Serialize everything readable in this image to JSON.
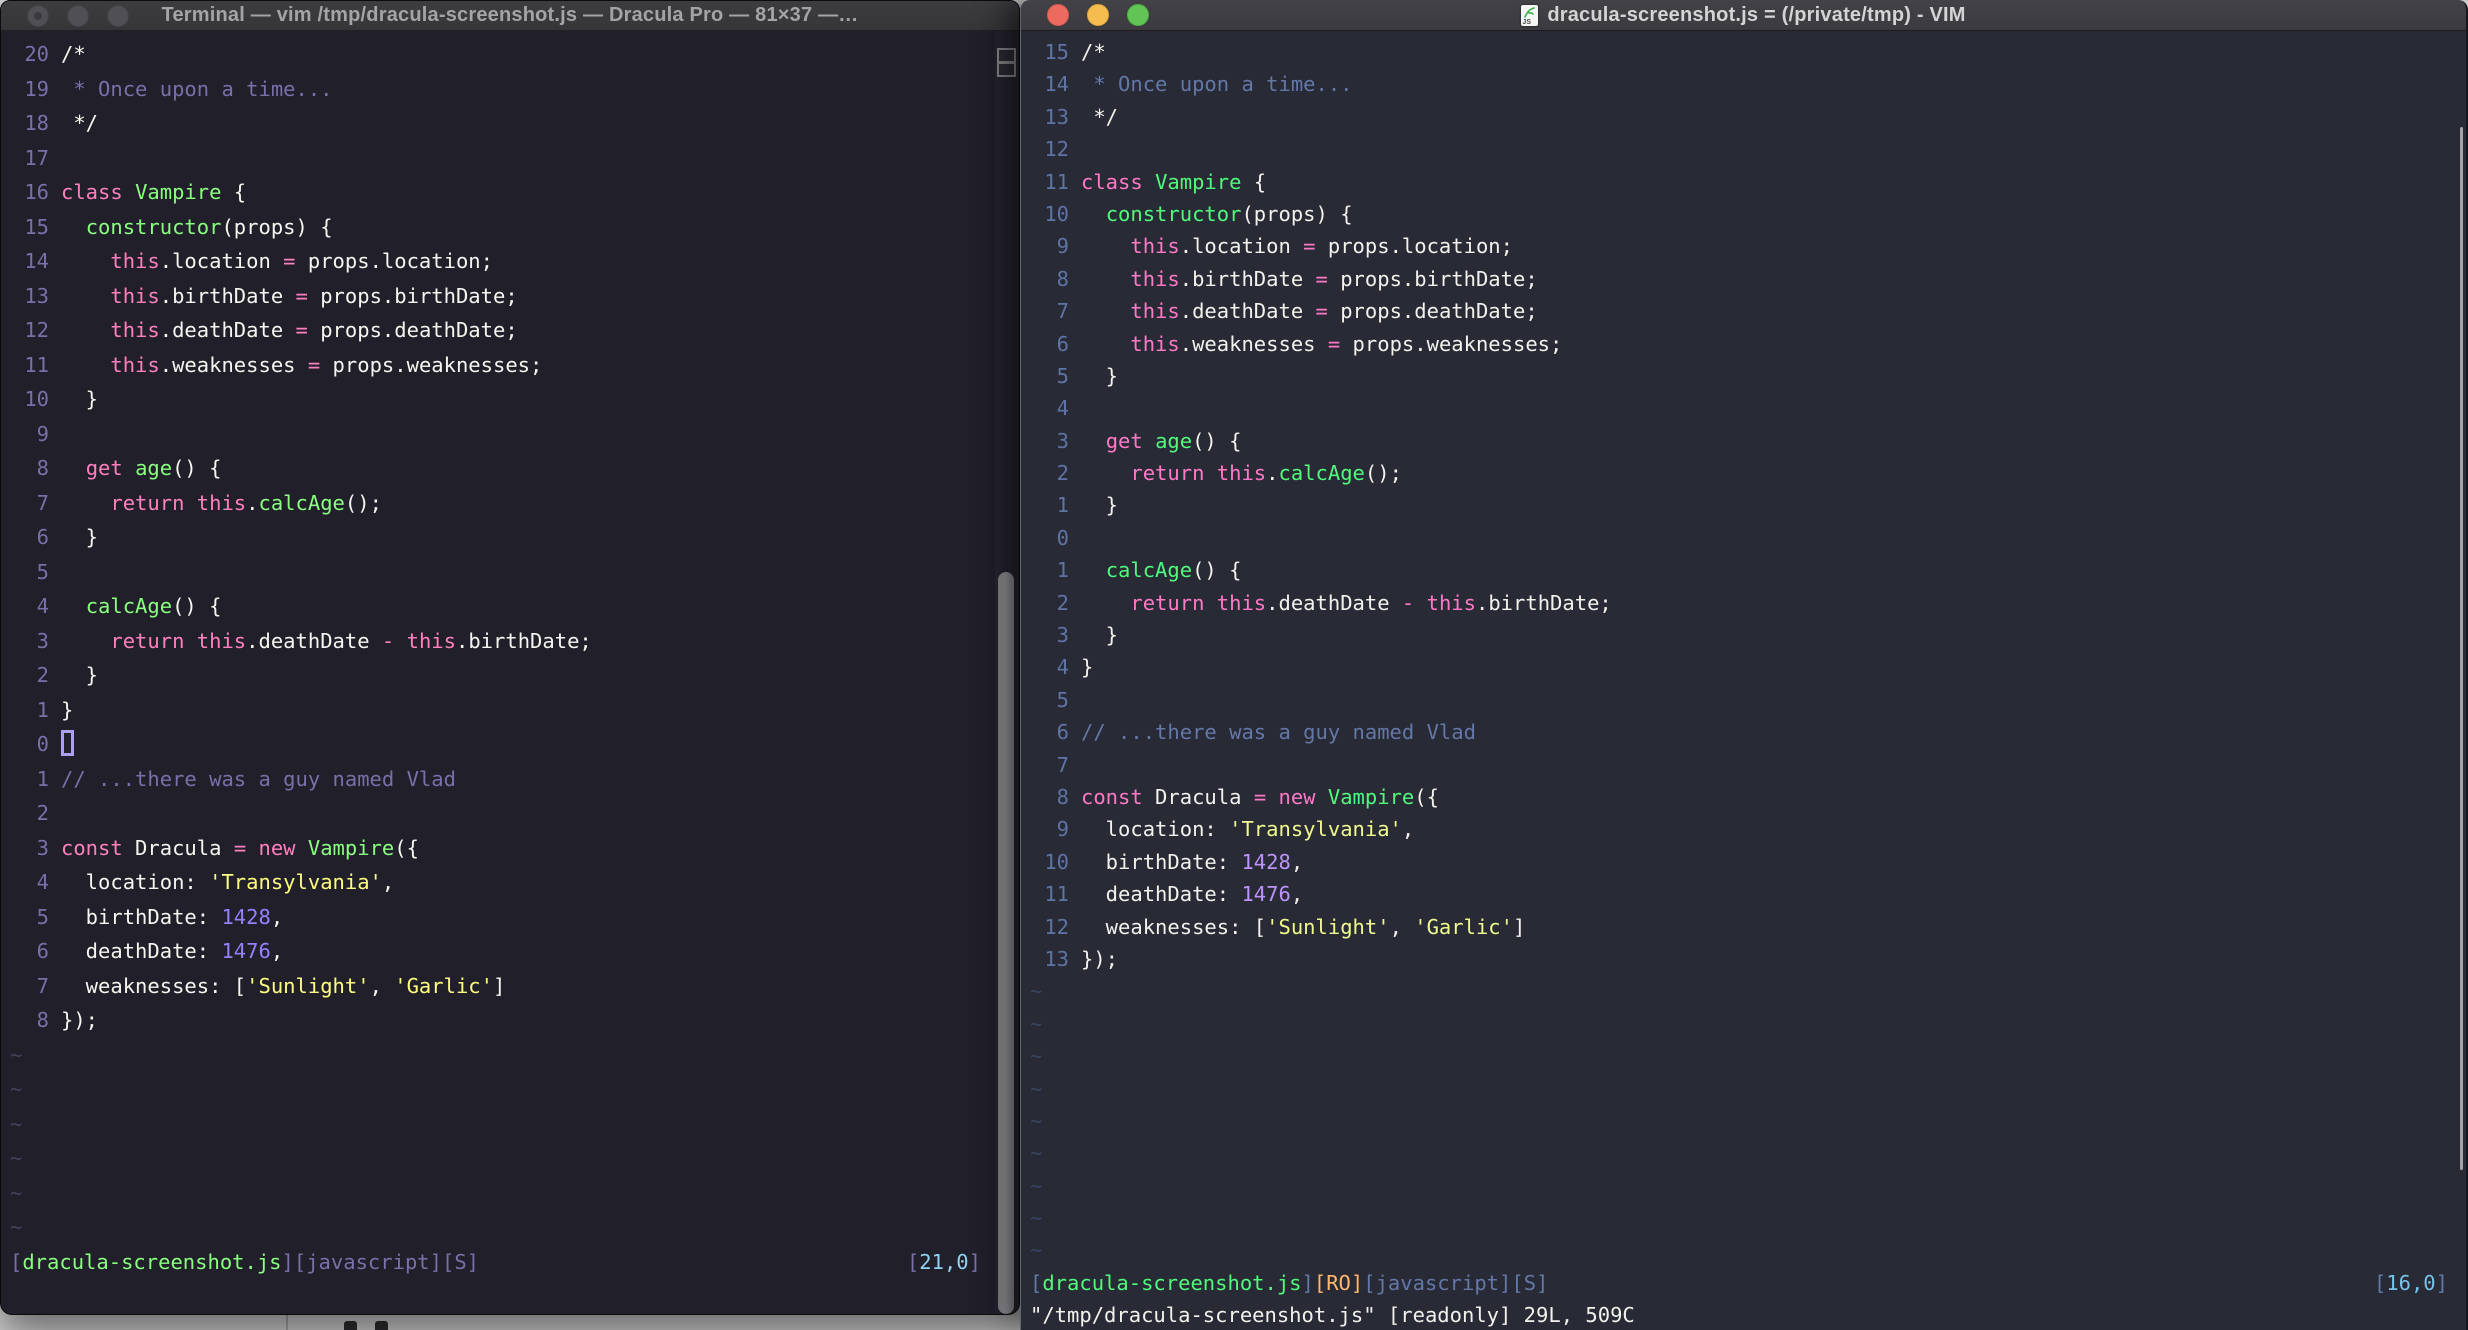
{
  "desktop": {
    "bg_color": "#d3d3d4"
  },
  "palettes": {
    "left": {
      "bg": "#201f2a",
      "fg": "#f6f6f0",
      "comment": "#7970a9",
      "pink": "#ff80bf",
      "green": "#8aff80",
      "purple": "#9580ff",
      "yellow": "#ffff80",
      "cyan": "#8fd2f2",
      "orange": "#ffca80",
      "linenr": "#7970a9",
      "tilde": "#46435a"
    },
    "right": {
      "bg": "#282a36",
      "fg": "#f2f2ec",
      "comment": "#6478a8",
      "pink": "#ff79c6",
      "green": "#50fa7b",
      "purple": "#bd93f9",
      "yellow": "#f1fa8c",
      "cyan": "#74c3e8",
      "orange": "#ffb86c",
      "linenr": "#5f74a5",
      "tilde": "#3a4463"
    }
  },
  "left_window": {
    "title": "Terminal — vim /tmp/dracula-screenshot.js — Dracula Pro — 81×37 —…",
    "palette": "left",
    "tilde_count": 6,
    "has_cmdline_text": false,
    "status_segs": [
      [
        "comment",
        "["
      ],
      [
        "green",
        "dracula-screenshot.js"
      ],
      [
        "comment",
        "][javascript][S]"
      ]
    ],
    "position_segs": [
      [
        "comment",
        "["
      ],
      [
        "cyan",
        "21,0"
      ],
      [
        "comment",
        "]"
      ]
    ],
    "cmdline_segs": [],
    "lines": [
      {
        "n": "20",
        "s": [
          [
            "fg",
            "/*"
          ]
        ]
      },
      {
        "n": "19",
        "s": [
          [
            "comment",
            " * Once upon a time..."
          ]
        ]
      },
      {
        "n": "18",
        "s": [
          [
            "fg",
            " */"
          ]
        ]
      },
      {
        "n": "17",
        "s": []
      },
      {
        "n": "16",
        "s": [
          [
            "pink",
            "class"
          ],
          [
            "fg",
            " "
          ],
          [
            "green",
            "Vampire"
          ],
          [
            "fg",
            " {"
          ]
        ]
      },
      {
        "n": "15",
        "s": [
          [
            "fg",
            "  "
          ],
          [
            "green",
            "constructor"
          ],
          [
            "fg",
            "(props) {"
          ]
        ]
      },
      {
        "n": "14",
        "s": [
          [
            "fg",
            "    "
          ],
          [
            "pink",
            "this"
          ],
          [
            "fg",
            ".location "
          ],
          [
            "pink",
            "="
          ],
          [
            "fg",
            " props.location;"
          ]
        ]
      },
      {
        "n": "13",
        "s": [
          [
            "fg",
            "    "
          ],
          [
            "pink",
            "this"
          ],
          [
            "fg",
            ".birthDate "
          ],
          [
            "pink",
            "="
          ],
          [
            "fg",
            " props.birthDate;"
          ]
        ]
      },
      {
        "n": "12",
        "s": [
          [
            "fg",
            "    "
          ],
          [
            "pink",
            "this"
          ],
          [
            "fg",
            ".deathDate "
          ],
          [
            "pink",
            "="
          ],
          [
            "fg",
            " props.deathDate;"
          ]
        ]
      },
      {
        "n": "11",
        "s": [
          [
            "fg",
            "    "
          ],
          [
            "pink",
            "this"
          ],
          [
            "fg",
            ".weaknesses "
          ],
          [
            "pink",
            "="
          ],
          [
            "fg",
            " props.weaknesses;"
          ]
        ]
      },
      {
        "n": "10",
        "s": [
          [
            "fg",
            "  }"
          ]
        ]
      },
      {
        "n": "9",
        "s": []
      },
      {
        "n": "8",
        "s": [
          [
            "fg",
            "  "
          ],
          [
            "pink",
            "get"
          ],
          [
            "fg",
            " "
          ],
          [
            "green",
            "age"
          ],
          [
            "fg",
            "() {"
          ]
        ]
      },
      {
        "n": "7",
        "s": [
          [
            "fg",
            "    "
          ],
          [
            "pink",
            "return"
          ],
          [
            "fg",
            " "
          ],
          [
            "pink",
            "this"
          ],
          [
            "fg",
            "."
          ],
          [
            "green",
            "calcAge"
          ],
          [
            "fg",
            "();"
          ]
        ]
      },
      {
        "n": "6",
        "s": [
          [
            "fg",
            "  }"
          ]
        ]
      },
      {
        "n": "5",
        "s": []
      },
      {
        "n": "4",
        "s": [
          [
            "fg",
            "  "
          ],
          [
            "green",
            "calcAge"
          ],
          [
            "fg",
            "() {"
          ]
        ]
      },
      {
        "n": "3",
        "s": [
          [
            "fg",
            "    "
          ],
          [
            "pink",
            "return"
          ],
          [
            "fg",
            " "
          ],
          [
            "pink",
            "this"
          ],
          [
            "fg",
            ".deathDate "
          ],
          [
            "pink",
            "-"
          ],
          [
            "fg",
            " "
          ],
          [
            "pink",
            "this"
          ],
          [
            "fg",
            ".birthDate;"
          ]
        ]
      },
      {
        "n": "2",
        "s": [
          [
            "fg",
            "  }"
          ]
        ]
      },
      {
        "n": "1",
        "s": [
          [
            "fg",
            "}"
          ]
        ]
      },
      {
        "n": "0",
        "cursor": true,
        "s": []
      },
      {
        "n": "1",
        "s": [
          [
            "comment",
            "// ...there was a guy named Vlad"
          ]
        ]
      },
      {
        "n": "2",
        "s": []
      },
      {
        "n": "3",
        "s": [
          [
            "pink",
            "const"
          ],
          [
            "fg",
            " Dracula "
          ],
          [
            "pink",
            "="
          ],
          [
            "fg",
            " "
          ],
          [
            "pink",
            "new"
          ],
          [
            "fg",
            " "
          ],
          [
            "green",
            "Vampire"
          ],
          [
            "fg",
            "({"
          ]
        ]
      },
      {
        "n": "4",
        "s": [
          [
            "fg",
            "  location: "
          ],
          [
            "yellow",
            "'Transylvania'"
          ],
          [
            "fg",
            ","
          ]
        ]
      },
      {
        "n": "5",
        "s": [
          [
            "fg",
            "  birthDate: "
          ],
          [
            "purple",
            "1428"
          ],
          [
            "fg",
            ","
          ]
        ]
      },
      {
        "n": "6",
        "s": [
          [
            "fg",
            "  deathDate: "
          ],
          [
            "purple",
            "1476"
          ],
          [
            "fg",
            ","
          ]
        ]
      },
      {
        "n": "7",
        "s": [
          [
            "fg",
            "  weaknesses: ["
          ],
          [
            "yellow",
            "'Sunlight'"
          ],
          [
            "fg",
            ", "
          ],
          [
            "yellow",
            "'Garlic'"
          ],
          [
            "fg",
            "]"
          ]
        ]
      },
      {
        "n": "8",
        "s": [
          [
            "fg",
            "});"
          ]
        ]
      }
    ]
  },
  "right_window": {
    "title": "dracula-screenshot.js = (/private/tmp) - VIM",
    "palette": "right",
    "tilde_count": 9,
    "has_cmdline_text": true,
    "status_segs": [
      [
        "comment",
        "["
      ],
      [
        "green",
        "dracula-screenshot.js"
      ],
      [
        "comment",
        "]"
      ],
      [
        "orange",
        "[RO]"
      ],
      [
        "comment",
        "[javascript][S]"
      ]
    ],
    "position_segs": [
      [
        "comment",
        "["
      ],
      [
        "cyan",
        "16,0"
      ],
      [
        "comment",
        "]"
      ]
    ],
    "cmdline_segs": [
      [
        "fg",
        "\"/tmp/dracula-screenshot.js\" [readonly] 29L, 509C"
      ]
    ],
    "lines": [
      {
        "n": "15",
        "s": [
          [
            "fg",
            "/*"
          ]
        ]
      },
      {
        "n": "14",
        "s": [
          [
            "comment",
            " * Once upon a time..."
          ]
        ]
      },
      {
        "n": "13",
        "s": [
          [
            "fg",
            " */"
          ]
        ]
      },
      {
        "n": "12",
        "s": []
      },
      {
        "n": "11",
        "s": [
          [
            "pink",
            "class"
          ],
          [
            "fg",
            " "
          ],
          [
            "green",
            "Vampire"
          ],
          [
            "fg",
            " {"
          ]
        ]
      },
      {
        "n": "10",
        "s": [
          [
            "fg",
            "  "
          ],
          [
            "green",
            "constructor"
          ],
          [
            "fg",
            "(props) {"
          ]
        ]
      },
      {
        "n": "9",
        "s": [
          [
            "fg",
            "    "
          ],
          [
            "pink",
            "this"
          ],
          [
            "fg",
            ".location "
          ],
          [
            "pink",
            "="
          ],
          [
            "fg",
            " props.location;"
          ]
        ]
      },
      {
        "n": "8",
        "s": [
          [
            "fg",
            "    "
          ],
          [
            "pink",
            "this"
          ],
          [
            "fg",
            ".birthDate "
          ],
          [
            "pink",
            "="
          ],
          [
            "fg",
            " props.birthDate;"
          ]
        ]
      },
      {
        "n": "7",
        "s": [
          [
            "fg",
            "    "
          ],
          [
            "pink",
            "this"
          ],
          [
            "fg",
            ".deathDate "
          ],
          [
            "pink",
            "="
          ],
          [
            "fg",
            " props.deathDate;"
          ]
        ]
      },
      {
        "n": "6",
        "s": [
          [
            "fg",
            "    "
          ],
          [
            "pink",
            "this"
          ],
          [
            "fg",
            ".weaknesses "
          ],
          [
            "pink",
            "="
          ],
          [
            "fg",
            " props.weaknesses;"
          ]
        ]
      },
      {
        "n": "5",
        "s": [
          [
            "fg",
            "  }"
          ]
        ]
      },
      {
        "n": "4",
        "s": []
      },
      {
        "n": "3",
        "s": [
          [
            "fg",
            "  "
          ],
          [
            "pink",
            "get"
          ],
          [
            "fg",
            " "
          ],
          [
            "green",
            "age"
          ],
          [
            "fg",
            "() {"
          ]
        ]
      },
      {
        "n": "2",
        "s": [
          [
            "fg",
            "    "
          ],
          [
            "pink",
            "return"
          ],
          [
            "fg",
            " "
          ],
          [
            "pink",
            "this"
          ],
          [
            "fg",
            "."
          ],
          [
            "green",
            "calcAge"
          ],
          [
            "fg",
            "();"
          ]
        ]
      },
      {
        "n": "1",
        "s": [
          [
            "fg",
            "  }"
          ]
        ]
      },
      {
        "n": "0",
        "s": []
      },
      {
        "n": "1",
        "s": [
          [
            "fg",
            "  "
          ],
          [
            "green",
            "calcAge"
          ],
          [
            "fg",
            "() {"
          ]
        ]
      },
      {
        "n": "2",
        "s": [
          [
            "fg",
            "    "
          ],
          [
            "pink",
            "return"
          ],
          [
            "fg",
            " "
          ],
          [
            "pink",
            "this"
          ],
          [
            "fg",
            ".deathDate "
          ],
          [
            "pink",
            "-"
          ],
          [
            "fg",
            " "
          ],
          [
            "pink",
            "this"
          ],
          [
            "fg",
            ".birthDate;"
          ]
        ]
      },
      {
        "n": "3",
        "s": [
          [
            "fg",
            "  }"
          ]
        ]
      },
      {
        "n": "4",
        "s": [
          [
            "fg",
            "}"
          ]
        ]
      },
      {
        "n": "5",
        "s": []
      },
      {
        "n": "6",
        "s": [
          [
            "comment",
            "// ...there was a guy named Vlad"
          ]
        ]
      },
      {
        "n": "7",
        "s": []
      },
      {
        "n": "8",
        "s": [
          [
            "pink",
            "const"
          ],
          [
            "fg",
            " Dracula "
          ],
          [
            "pink",
            "="
          ],
          [
            "fg",
            " "
          ],
          [
            "pink",
            "new"
          ],
          [
            "fg",
            " "
          ],
          [
            "green",
            "Vampire"
          ],
          [
            "fg",
            "({"
          ]
        ]
      },
      {
        "n": "9",
        "s": [
          [
            "fg",
            "  location: "
          ],
          [
            "yellow",
            "'Transylvania'"
          ],
          [
            "fg",
            ","
          ]
        ]
      },
      {
        "n": "10",
        "s": [
          [
            "fg",
            "  birthDate: "
          ],
          [
            "purple",
            "1428"
          ],
          [
            "fg",
            ","
          ]
        ]
      },
      {
        "n": "11",
        "s": [
          [
            "fg",
            "  deathDate: "
          ],
          [
            "purple",
            "1476"
          ],
          [
            "fg",
            ","
          ]
        ]
      },
      {
        "n": "12",
        "s": [
          [
            "fg",
            "  weaknesses: ["
          ],
          [
            "yellow",
            "'Sunlight'"
          ],
          [
            "fg",
            ", "
          ],
          [
            "yellow",
            "'Garlic'"
          ],
          [
            "fg",
            "]"
          ]
        ]
      },
      {
        "n": "13",
        "s": [
          [
            "fg",
            "});"
          ]
        ]
      }
    ]
  }
}
